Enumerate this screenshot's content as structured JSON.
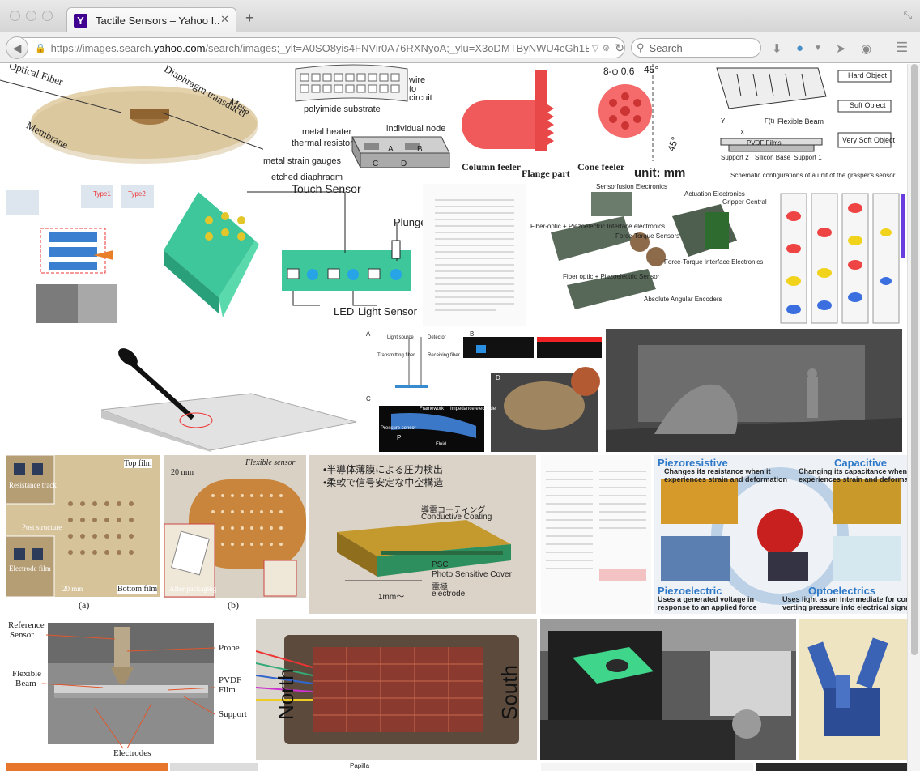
{
  "browser": {
    "tab_title": "Tactile Sensors – Yahoo I...",
    "tab_close": "✕",
    "new_tab": "+",
    "url_prefix": "https://images.search.",
    "url_domain": "yahoo.com",
    "url_rest": "/search/images;_ylt=A0SO8yis4FNVir0A76RXNyoA;_ylu=X3oDMTByNWU4cGh1B",
    "search_placeholder": "Search",
    "favicon_letter": "Y"
  },
  "results": {
    "t1": {
      "a": "Optical Fiber",
      "b": "Diaphragm transducer",
      "c": "Membrane",
      "d": "Mesa"
    },
    "t2": {
      "a": "wire",
      "b": "to",
      "c": "circuit",
      "d": "polyimide substrate",
      "e": "metal heater",
      "f": "thermal resistor",
      "g": "individual node",
      "h": "metal strain gauges",
      "i": "etched diaphragm",
      "j": "A",
      "k": "B",
      "l": "C",
      "m": "D"
    },
    "t3": {
      "a": "8-φ 0.6",
      "b": "45°",
      "c": "Column feeler",
      "d": "Flange part",
      "e": "Cone feeler",
      "f": "unit: mm",
      "g": "45°"
    },
    "t4": {
      "a": "Hard Object",
      "b": "Soft Object",
      "c": "Very Soft Object",
      "d": "Flexible Beam",
      "e": "PVDF Films",
      "f": "Support 2",
      "g": "Silicon Base",
      "h": "Support 1",
      "i": "Schematic configurations of a unit of the grasper's sensor",
      "j": "F(t)",
      "k": "Y",
      "l": "X"
    },
    "t5": {
      "a": "Type1",
      "b": "Type2"
    },
    "t6": {
      "a": "Touch Sensor",
      "b": "Plunger",
      "c": "LED",
      "d": "Light Sensor"
    },
    "t8": {
      "a": "Sensorfusion Electronics",
      "b": "Actuation Electronics",
      "c": "Gripper Central Electronics",
      "d": "Fiber-optic + Piezoelectric Interface electronics",
      "e": "Force-Torque Sensors",
      "f": "Force-Torque Interface Electronics",
      "g": "Fiber optic + Piezoelectric Sensor",
      "h": "Absolute Angular Encoders"
    },
    "t11": {
      "a": "A",
      "b": "B",
      "c": "C",
      "d": "D",
      "e": "Light source",
      "f": "Detector",
      "g": "Transmitting fiber",
      "h": "Receiving fiber",
      "i": "Framework",
      "j": "Impedance electrode",
      "k": "Pressure sensor",
      "l": "Fluid",
      "m": "P"
    },
    "t13": {
      "a": "Top film",
      "b": "Resistance track",
      "c": "Post structure",
      "d": "Bottom film",
      "e": "(a)",
      "f": "Electrode film",
      "g": "20 mm"
    },
    "t14": {
      "a": "Flexible sensor",
      "b": "20 mm",
      "c": "After packaging",
      "d": "(b)"
    },
    "t15": {
      "a": "•半導体薄膜による圧力検出",
      "b": "•柔軟で信号安定な中空構造",
      "c": "導電コーティング",
      "d": "Conductive Coating",
      "e": "PSC",
      "f": "Photo Sensitive Cover",
      "g": "電極",
      "h": "electrode",
      "i": "1mm〜"
    },
    "t17": {
      "a": "Piezoresistive",
      "b": "Changes its resistance when it",
      "c": "experiences strain and deformation",
      "d": "Capacitive",
      "e": "Changing its capacitance when",
      "f": "experiences strain and deformation",
      "g": "Piezoelectric",
      "h": "Uses a generated voltage in",
      "i": "response to an applied force",
      "j": "Optoelectrics",
      "k": "Uses light as an intermediate for conv",
      "l": "verting pressure into electrical signal"
    },
    "t18": {
      "a": "Reference",
      "b": "Sensor",
      "c": "Probe",
      "d": "Flexible",
      "e": "Beam",
      "f": "PVDF",
      "g": "Film",
      "h": "Support",
      "i": "Electrodes"
    },
    "t19": {
      "a": "North",
      "b": "South"
    },
    "t22": {
      "a": "Papilla"
    }
  }
}
